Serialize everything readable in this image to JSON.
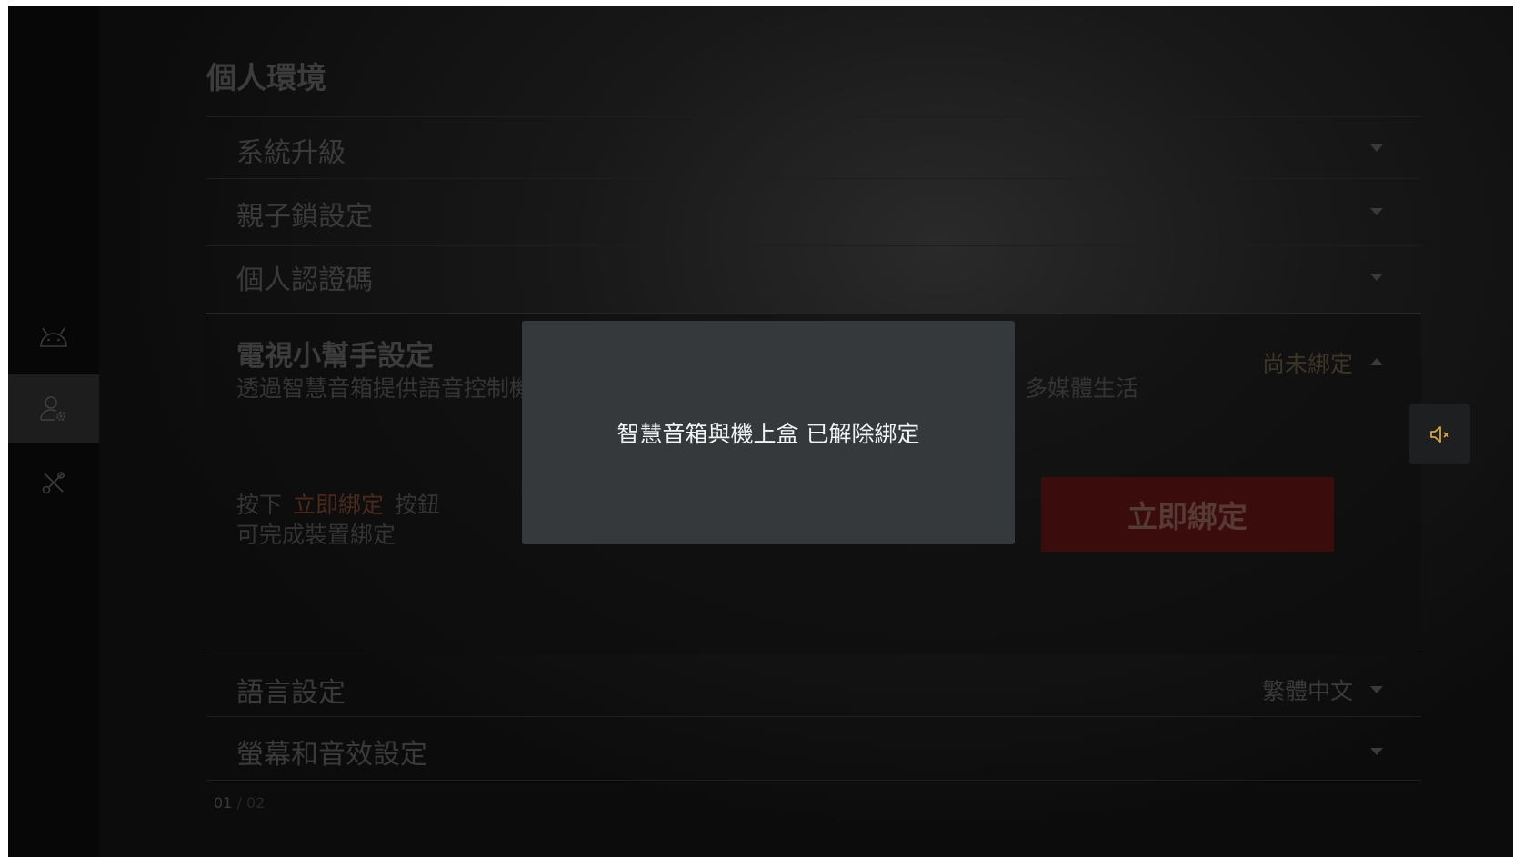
{
  "nav": {
    "items": [
      {
        "icon": "android-icon"
      },
      {
        "icon": "user-settings-icon",
        "active": true
      },
      {
        "icon": "tools-icon"
      }
    ]
  },
  "page": {
    "title": "個人環境"
  },
  "settings": {
    "system_upgrade": "系統升級",
    "parental_lock": "親子鎖設定",
    "personal_pin": "個人認證碼",
    "language": {
      "label": "語言設定",
      "value": "繁體中文"
    },
    "display_audio": "螢幕和音效設定"
  },
  "tv_assistant": {
    "title": "電視小幫手設定",
    "description_left": "透過智慧音箱提供語音控制機",
    "description_right": "多媒體生活",
    "status": "尚未綁定",
    "instruction_prefix": "按下",
    "instruction_highlight": "立即綁定",
    "instruction_suffix": "按鈕",
    "instruction_line2": "可完成裝置綁定",
    "bind_button_label": "立即綁定"
  },
  "pager": {
    "current": "01",
    "separator": "/",
    "total": "02"
  },
  "toast": {
    "message": "智慧音箱與機上盒 已解除綁定"
  },
  "colors": {
    "accent_red": "#3b0c0c",
    "toast_bg": "#35393b",
    "mute_icon": "#d9a441"
  }
}
